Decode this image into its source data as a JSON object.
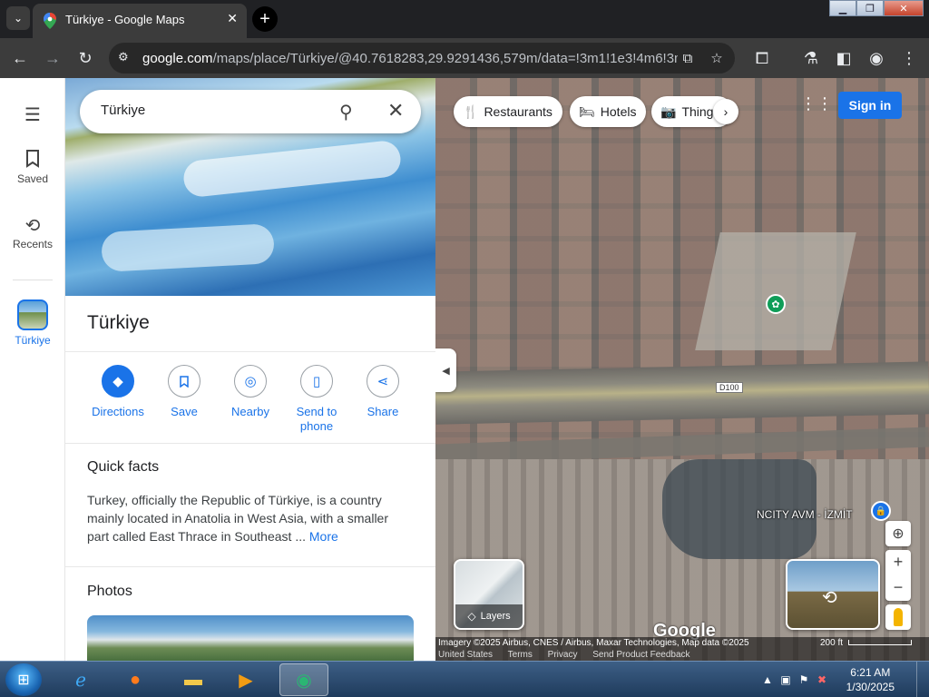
{
  "browser": {
    "tab_title": "Türkiye - Google Maps",
    "url_host": "google.com",
    "url_path": "/maps/place/Türkiye/@40.7618283,29.9291436,579m/data=!3m1!1e3!4m6!3m5!1...",
    "new_tab_symbol": "+",
    "close_symbol": "✕"
  },
  "rail": {
    "menu_icon": "hamburger-icon",
    "items": [
      {
        "label": "Saved",
        "icon": "bookmark-icon"
      },
      {
        "label": "Recents",
        "icon": "history-icon"
      },
      {
        "label": "Türkiye",
        "icon": "place-thumbnail"
      }
    ]
  },
  "search": {
    "value": "Türkiye"
  },
  "place": {
    "title": "Türkiye",
    "actions": [
      {
        "label": "Directions",
        "icon": "directions-icon"
      },
      {
        "label": "Save",
        "icon": "bookmark-icon"
      },
      {
        "label": "Nearby",
        "icon": "nearby-icon"
      },
      {
        "label": "Send to\nphone",
        "icon": "send-to-phone-icon"
      },
      {
        "label": "Share",
        "icon": "share-icon"
      }
    ],
    "quick_facts": {
      "title": "Quick facts",
      "text": "Turkey, officially the Republic of Türkiye, is a country mainly located in Anatolia in West Asia, with a smaller part called East Thrace in Southeast ... ",
      "more": "More"
    },
    "photos_title": "Photos"
  },
  "map": {
    "chips": [
      {
        "label": "Restaurants",
        "icon": "fork-knife-icon"
      },
      {
        "label": "Hotels",
        "icon": "bed-icon"
      },
      {
        "label": "Things to do",
        "icon": "camera-icon"
      }
    ],
    "sign_in": "Sign in",
    "road_label": "D100",
    "poi_label": "NCITY AVM - İZMİT",
    "layers_label": "Layers",
    "google_logo": "Google",
    "attribution": "Imagery ©2025 Airbus, CNES / Airbus, Maxar Technologies, Map data ©2025",
    "footer_links": [
      "United States",
      "Terms",
      "Privacy",
      "Send Product Feedback"
    ],
    "scale": "200 ft"
  },
  "taskbar": {
    "time": "6:21 AM",
    "date": "1/30/2025",
    "apps": [
      "internet-explorer",
      "firefox",
      "file-explorer",
      "media-player",
      "chrome"
    ]
  },
  "colors": {
    "accent": "#1a73e8",
    "chrome_dark": "#202124",
    "toolbar": "#3c3c3c"
  }
}
